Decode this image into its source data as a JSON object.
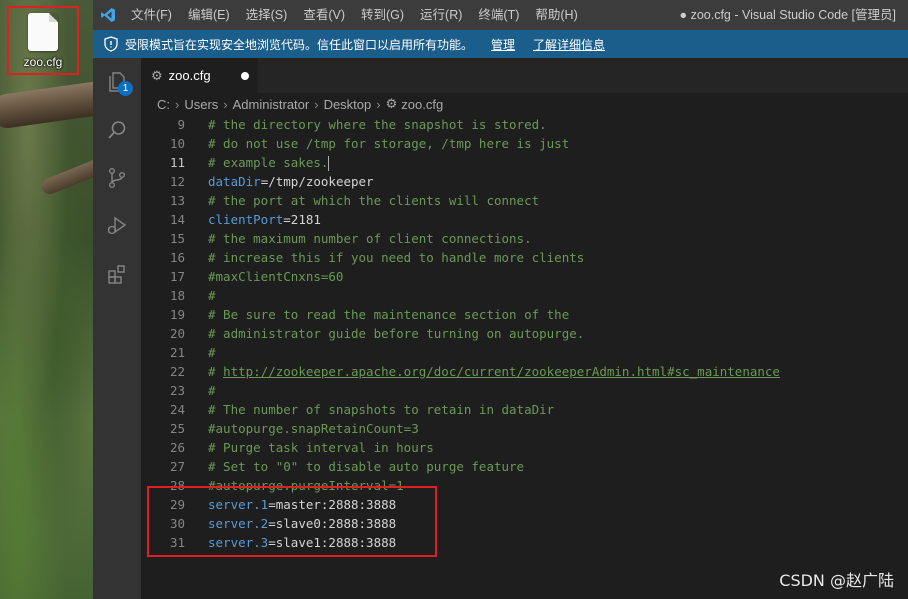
{
  "desktop": {
    "icon_label": "zoo.cfg"
  },
  "titlebar": {
    "menu": [
      "文件(F)",
      "编辑(E)",
      "选择(S)",
      "查看(V)",
      "转到(G)",
      "运行(R)",
      "终端(T)",
      "帮助(H)"
    ],
    "title": "● zoo.cfg - Visual Studio Code [管理员]"
  },
  "banner": {
    "text": "受限模式旨在实现安全地浏览代码。信任此窗口以启用所有功能。",
    "manage": "管理",
    "learn_more": "了解详细信息"
  },
  "activity": {
    "explorer_badge": "1"
  },
  "tab": {
    "label": "zoo.cfg",
    "icon": "gear-icon"
  },
  "breadcrumbs": [
    "C:",
    "Users",
    "Administrator",
    "Desktop",
    "zoo.cfg"
  ],
  "code": {
    "active_line": "11",
    "lines": [
      {
        "n": "9",
        "parts": [
          {
            "t": "# the directory where the snapshot is stored.",
            "c": "comment"
          }
        ]
      },
      {
        "n": "10",
        "parts": [
          {
            "t": "# do not use /tmp for storage, /tmp here is just",
            "c": "comment"
          }
        ]
      },
      {
        "n": "11",
        "parts": [
          {
            "t": "# example sakes.",
            "c": "comment"
          }
        ],
        "cursor": true
      },
      {
        "n": "12",
        "parts": [
          {
            "t": "dataDir",
            "c": "key"
          },
          {
            "t": "=/tmp/zookeeper",
            "c": "val"
          }
        ]
      },
      {
        "n": "13",
        "parts": [
          {
            "t": "# the port at which the clients will connect",
            "c": "comment"
          }
        ]
      },
      {
        "n": "14",
        "parts": [
          {
            "t": "clientPort",
            "c": "key"
          },
          {
            "t": "=2181",
            "c": "val"
          }
        ]
      },
      {
        "n": "15",
        "parts": [
          {
            "t": "# the maximum number of client connections.",
            "c": "comment"
          }
        ]
      },
      {
        "n": "16",
        "parts": [
          {
            "t": "# increase this if you need to handle more clients",
            "c": "comment"
          }
        ]
      },
      {
        "n": "17",
        "parts": [
          {
            "t": "#maxClientCnxns=60",
            "c": "comment"
          }
        ]
      },
      {
        "n": "18",
        "parts": [
          {
            "t": "#",
            "c": "comment"
          }
        ]
      },
      {
        "n": "19",
        "parts": [
          {
            "t": "# Be sure to read the maintenance section of the",
            "c": "comment"
          }
        ]
      },
      {
        "n": "20",
        "parts": [
          {
            "t": "# administrator guide before turning on autopurge.",
            "c": "comment"
          }
        ]
      },
      {
        "n": "21",
        "parts": [
          {
            "t": "#",
            "c": "comment"
          }
        ]
      },
      {
        "n": "22",
        "parts": [
          {
            "t": "# ",
            "c": "comment"
          },
          {
            "t": "http://zookeeper.apache.org/doc/current/zookeeperAdmin.html#sc_maintenance",
            "c": "link"
          }
        ]
      },
      {
        "n": "23",
        "parts": [
          {
            "t": "#",
            "c": "comment"
          }
        ]
      },
      {
        "n": "24",
        "parts": [
          {
            "t": "# The number of snapshots to retain in dataDir",
            "c": "comment"
          }
        ]
      },
      {
        "n": "25",
        "parts": [
          {
            "t": "#autopurge.snapRetainCount=3",
            "c": "comment"
          }
        ]
      },
      {
        "n": "26",
        "parts": [
          {
            "t": "# Purge task interval in hours",
            "c": "comment"
          }
        ]
      },
      {
        "n": "27",
        "parts": [
          {
            "t": "# Set to \"0\" to disable auto purge feature",
            "c": "comment"
          }
        ]
      },
      {
        "n": "28",
        "parts": [
          {
            "t": "#autopurge.purgeInterval=1",
            "c": "comment"
          }
        ]
      },
      {
        "n": "29",
        "parts": [
          {
            "t": "server.1",
            "c": "key"
          },
          {
            "t": "=master:2888:3888",
            "c": "val"
          }
        ]
      },
      {
        "n": "30",
        "parts": [
          {
            "t": "server.2",
            "c": "key"
          },
          {
            "t": "=slave0:2888:3888",
            "c": "val"
          }
        ]
      },
      {
        "n": "31",
        "parts": [
          {
            "t": "server.3",
            "c": "key"
          },
          {
            "t": "=slave1:2888:3888",
            "c": "val"
          }
        ]
      }
    ]
  },
  "watermark": "CSDN @赵广陆",
  "colors": {
    "accent_blue": "#1b5e8c",
    "highlight_red": "#e02020",
    "comment": "#6a9955",
    "keyword": "#569cd6"
  }
}
